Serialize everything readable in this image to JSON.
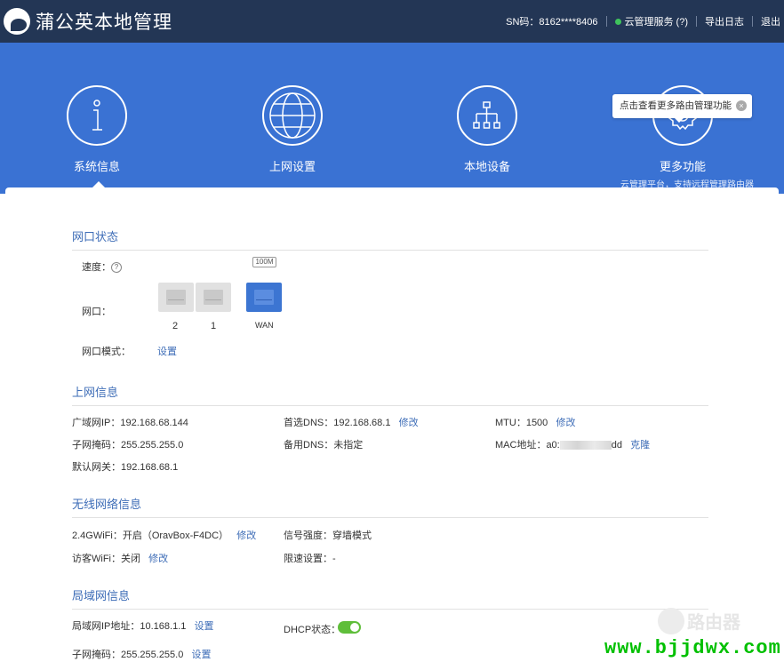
{
  "header": {
    "brand": "蒲公英本地管理",
    "sn": "SN码：8162****8406",
    "cloud_service": "云管理服务 (?)",
    "export_log": "导出日志",
    "logout": "退出"
  },
  "nav": {
    "tooltip": "点击查看更多路由管理功能",
    "items": [
      {
        "label": "系统信息",
        "icon": "info-icon"
      },
      {
        "label": "上网设置",
        "icon": "globe-icon"
      },
      {
        "label": "本地设备",
        "icon": "network-tree-icon"
      },
      {
        "label": "更多功能",
        "sub": "云管理平台，支持远程管理路由器",
        "icon": "gear-icon"
      }
    ]
  },
  "port_status": {
    "title": "网口状态",
    "speed_label": "速度：",
    "speed_tag": "100M",
    "port_label": "网口：",
    "ports": [
      "2",
      "1",
      "WAN"
    ],
    "mode_label": "网口模式：",
    "mode_link": "设置"
  },
  "internet": {
    "title": "上网信息",
    "wan_ip": "广域网IP：192.168.68.144",
    "subnet": "子网掩码：255.255.255.0",
    "gateway": "默认网关：192.168.68.1",
    "dns1": "首选DNS：192.168.68.1",
    "dns1_link": "修改",
    "dns2": "备用DNS：未指定",
    "mtu": "MTU：1500",
    "mtu_link": "修改",
    "mac_prefix": "MAC地址：a0:",
    "mac_suffix": "dd",
    "mac_link": "克隆"
  },
  "wireless": {
    "title": "无线网络信息",
    "wifi24": "2.4GWiFi：开启（OravBox-F4DC）",
    "wifi24_link": "修改",
    "guest": "访客WiFi：关闭",
    "guest_link": "修改",
    "signal": "信号强度：穿墙模式",
    "limit": "限速设置：-"
  },
  "lan": {
    "title": "局域网信息",
    "lan_ip": "局域网IP地址：10.168.1.1",
    "lan_ip_link": "设置",
    "subnet": "子网掩码：255.255.255.0",
    "subnet_link": "设置",
    "dhcp": "DHCP状态："
  },
  "watermark": {
    "url": "www.bjjdwx.com",
    "brand": "路由器"
  },
  "colors": {
    "topbar": "#233655",
    "nav": "#3a72d3",
    "link": "#3e6db7",
    "toggle_on": "#5fbe3a"
  }
}
